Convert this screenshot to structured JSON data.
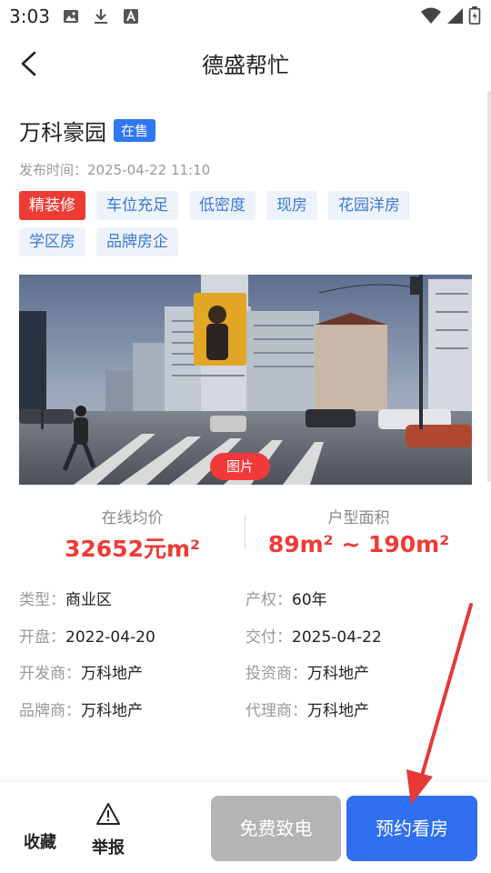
{
  "statusbar": {
    "time": "3:03"
  },
  "header": {
    "title": "德盛帮忙"
  },
  "property": {
    "name": "万科豪园",
    "status": "在售",
    "publish_label": "发布时间：",
    "publish_time": "2025-04-22 11:10"
  },
  "tags": [
    {
      "label": "精装修",
      "primary": true
    },
    {
      "label": "车位充足"
    },
    {
      "label": "低密度"
    },
    {
      "label": "现房"
    },
    {
      "label": "花园洋房"
    },
    {
      "label": "学区房"
    },
    {
      "label": "品牌房企"
    }
  ],
  "photo": {
    "button_label": "图片"
  },
  "stats": [
    {
      "label": "在线均价",
      "value": "32652元m²"
    },
    {
      "label": "户型面积",
      "value": "89m² ~ 190m²"
    }
  ],
  "info": [
    {
      "key": "类型：",
      "value": "商业区"
    },
    {
      "key": "产权：",
      "value": "60年"
    },
    {
      "key": "开盘：",
      "value": "2022-04-20"
    },
    {
      "key": "交付：",
      "value": "2025-04-22"
    },
    {
      "key": "开发商：",
      "value": "万科地产"
    },
    {
      "key": "投资商：",
      "value": "万科地产"
    },
    {
      "key": "品牌商：",
      "value": "万科地产"
    },
    {
      "key": "代理商：",
      "value": "万科地产"
    }
  ],
  "bottombar": {
    "favorite_label": "收藏",
    "report_label": "举报",
    "call_label": "免费致电",
    "book_label": "预约看房"
  },
  "colors": {
    "accent": "#2f6ff0",
    "price": "#ef3b36",
    "tag_text": "#3a78d4",
    "tag_bg": "#eef3fb",
    "disabled_button": "#b4b4b4"
  },
  "icons": [
    "back-icon",
    "image-icon",
    "download-icon",
    "text-icon",
    "wifi-icon",
    "signal-icon",
    "battery-icon",
    "warning-icon"
  ]
}
